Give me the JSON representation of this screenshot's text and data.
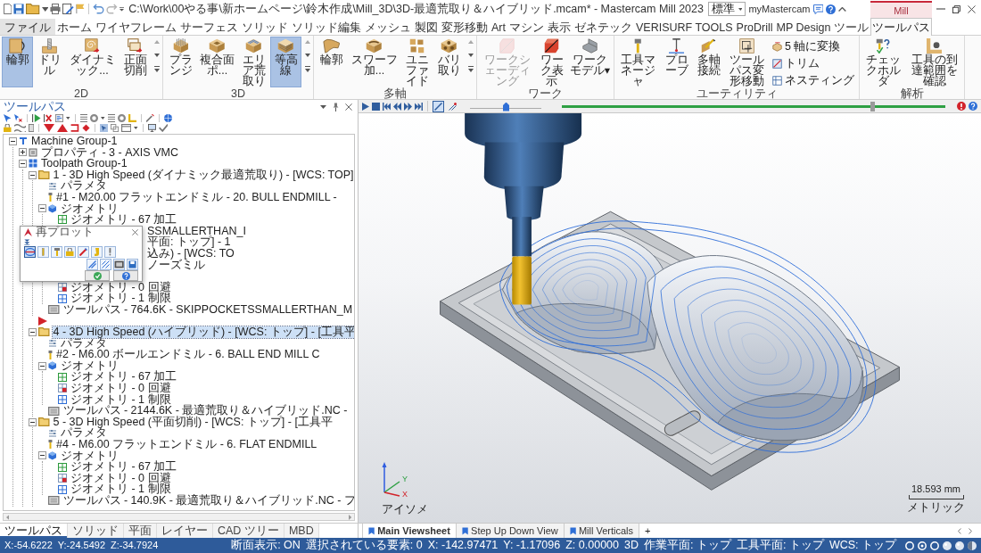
{
  "title_bar": {
    "title": "C:\\Work\\00やる事\\新ホームページ\\鈴木作成\\Mill_3D\\3D-最適荒取り＆ハイブリッド.mcam* - Mastercam Mill 2023",
    "context_tab": "Mill"
  },
  "menu_tabs": [
    {
      "label": "ファイル",
      "kind": "file",
      "selected": false
    },
    {
      "label": "ホーム",
      "kind": "tab",
      "selected": false
    },
    {
      "label": "ワイヤフレーム",
      "kind": "tab",
      "selected": false
    },
    {
      "label": "サーフェス",
      "kind": "tab",
      "selected": false
    },
    {
      "label": "ソリッド",
      "kind": "tab",
      "selected": false
    },
    {
      "label": "ソリッド編集",
      "kind": "tab",
      "selected": false
    },
    {
      "label": "メッシュ",
      "kind": "tab",
      "selected": false
    },
    {
      "label": "製図",
      "kind": "tab",
      "selected": false
    },
    {
      "label": "変形移動",
      "kind": "tab",
      "selected": false
    },
    {
      "label": "Art",
      "kind": "tab",
      "selected": false
    },
    {
      "label": "マシン",
      "kind": "tab",
      "selected": false
    },
    {
      "label": "表示",
      "kind": "tab",
      "selected": false
    },
    {
      "label": "ゼネテック",
      "kind": "tab",
      "selected": false
    },
    {
      "label": "VERISURF TOOLS",
      "kind": "tab",
      "selected": false
    },
    {
      "label": "ProDrill",
      "kind": "tab",
      "selected": false
    },
    {
      "label": "MP Design ツール",
      "kind": "tab",
      "selected": false
    },
    {
      "label": "ツールパス",
      "kind": "tab",
      "selected": true
    }
  ],
  "view_style": {
    "value": "標準"
  },
  "account_link": "myMastercam",
  "ribbon": [
    {
      "label": "2D",
      "gallery": true,
      "buttons": [
        {
          "label": "輪郭",
          "selected": true
        },
        {
          "label": "ドリル",
          "selected": false
        },
        {
          "label": "ダイナミック...",
          "selected": false
        },
        {
          "label": "正面切削",
          "selected": false
        }
      ]
    },
    {
      "label": "3D",
      "gallery": true,
      "buttons": [
        {
          "label": "プランジ",
          "selected": false
        },
        {
          "label": "複合面ポ...",
          "selected": false
        },
        {
          "label": "エリア荒取り",
          "selected": false
        },
        {
          "label": "等高線",
          "selected": true
        }
      ]
    },
    {
      "label": "多軸",
      "gallery": true,
      "buttons": [
        {
          "label": "輪郭",
          "selected": false
        },
        {
          "label": "スワーフ加...",
          "selected": false
        },
        {
          "label": "ユニファイド",
          "selected": false
        },
        {
          "label": "バリ取り",
          "selected": false
        }
      ]
    },
    {
      "label": "ワーク",
      "buttons": [
        {
          "label": "ワークシェーディング",
          "selected": false,
          "disabled": true
        },
        {
          "label": "ワーク表示",
          "selected": false,
          "disabled": false
        },
        {
          "label": "ワークモデル▾",
          "selected": false,
          "disabled": false
        }
      ]
    },
    {
      "label": "ユーティリティ",
      "buttons": [
        {
          "label": "工具マネージャ",
          "selected": false
        },
        {
          "label": "プローブ",
          "selected": false
        },
        {
          "label": "多軸接続",
          "selected": false
        },
        {
          "label": "ツールパス変形移動",
          "selected": false
        }
      ],
      "small_buttons": [
        {
          "label": "5 軸に変換"
        },
        {
          "label": "トリム"
        },
        {
          "label": "ネスティング"
        }
      ]
    },
    {
      "label": "解析",
      "buttons": [
        {
          "label": "チェックホルダ",
          "selected": false
        },
        {
          "label": "工具の到達範囲を確認",
          "selected": false
        }
      ]
    }
  ],
  "panel": {
    "title": "ツールパス",
    "tree": [
      {
        "text": "Machine Group-1",
        "kind": "machine",
        "expanded": true,
        "selected": false,
        "children": [
          {
            "text": "プロパティ - 3 - AXIS VMC",
            "kind": "properties",
            "expanded": false,
            "selected": false
          },
          {
            "text": "Toolpath Group-1",
            "kind": "group",
            "expanded": true,
            "selected": false,
            "children": [
              {
                "text": "1 - 3D High Speed (ダイナミック最適荒取り) - [WCS: TOP]",
                "kind": "operation",
                "expanded": true,
                "selected": false,
                "children": [
                  {
                    "text": "パラメタ",
                    "kind": "params",
                    "selected": false
                  },
                  {
                    "text": "#1 - M20.00 フラットエンドミル - 20. BULL ENDMILL -",
                    "kind": "tool",
                    "selected": false
                  },
                  {
                    "text": "ジオメトリ",
                    "kind": "geometry",
                    "expanded": true,
                    "selected": false,
                    "children": [
                      {
                        "text": "ジオメトリ - 67 加工",
                        "kind": "cutchain",
                        "selected": false
                      }
                    ]
                  },
                  {
                    "text": "SSMALLERTHAN_I",
                    "covered": true,
                    "selected": false
                  }
                ]
              },
              {
                "text": "平面: トップ] - 1",
                "covered": true,
                "selected": false
              },
              {
                "text": "込み) - [WCS: TO",
                "covered": true,
                "selected": false,
                "children": [
                  {
                    "text": "ノーズミル",
                    "covered": true,
                    "selected": false
                  },
                  {
                    "covered": true,
                    "children": [
                      {
                        "text": "ジオメトリ - 0 回避",
                        "kind": "avoidchain",
                        "selected": false
                      },
                      {
                        "text": "ジオメトリ - 1 制限",
                        "kind": "limitchain",
                        "selected": false
                      }
                    ]
                  },
                  {
                    "text": "ツールパス - 764.6K - SKIPPOCKETSSMALLERTHAN_M",
                    "kind": "toolpath",
                    "selected": false
                  }
                ]
              },
              {
                "kind": "marker"
              },
              {
                "text": "4 - 3D High Speed (ハイブリッド) - [WCS: トップ] - [工具平",
                "kind": "operation",
                "expanded": true,
                "selected": true,
                "children": [
                  {
                    "text": "パラメタ",
                    "kind": "params",
                    "selected": false
                  },
                  {
                    "text": "#2 - M6.00 ボールエンドミル - 6. BALL END MILL C",
                    "kind": "tool",
                    "selected": false
                  },
                  {
                    "text": "ジオメトリ",
                    "kind": "geometry",
                    "expanded": true,
                    "selected": false,
                    "children": [
                      {
                        "text": "ジオメトリ - 67 加工",
                        "kind": "cutchain",
                        "selected": false
                      },
                      {
                        "text": "ジオメトリ - 0 回避",
                        "kind": "avoidchain",
                        "selected": false
                      },
                      {
                        "text": "ジオメトリ - 1 制限",
                        "kind": "limitchain",
                        "selected": false
                      }
                    ]
                  },
                  {
                    "text": "ツールパス - 2144.6K - 最適荒取り＆ハイブリッド.NC -",
                    "kind": "toolpath",
                    "selected": false
                  }
                ]
              },
              {
                "text": "5 - 3D High Speed (平面切削) - [WCS: トップ] - [工具平",
                "kind": "operation",
                "expanded": true,
                "selected": false,
                "children": [
                  {
                    "text": "パラメタ",
                    "kind": "params",
                    "selected": false
                  },
                  {
                    "text": "#4 - M6.00 フラットエンドミル - 6. FLAT ENDMILL",
                    "kind": "tool",
                    "selected": false
                  },
                  {
                    "text": "ジオメトリ",
                    "kind": "geometry",
                    "expanded": true,
                    "selected": false,
                    "children": [
                      {
                        "text": "ジオメトリ - 67 加工",
                        "kind": "cutchain",
                        "selected": false
                      },
                      {
                        "text": "ジオメトリ - 0 回避",
                        "kind": "avoidchain",
                        "selected": false
                      },
                      {
                        "text": "ジオメトリ - 1 制限",
                        "kind": "limitchain",
                        "selected": false
                      }
                    ]
                  },
                  {
                    "text": "ツールパス - 140.9K - 最適荒取り＆ハイブリッド.NC - フ",
                    "kind": "toolpath",
                    "selected": false
                  }
                ]
              }
            ]
          }
        ]
      }
    ]
  },
  "dialog": {
    "title": "再プロット",
    "display_options": [
      {
        "on": true
      },
      {
        "on": false
      },
      {
        "on": false
      },
      {
        "on": false
      },
      {
        "on": false
      },
      {
        "on": false
      },
      {
        "on": false
      }
    ],
    "output_options": [
      {
        "on": false
      },
      {
        "on": false
      },
      {
        "on": false
      },
      {
        "on": false
      }
    ]
  },
  "viewport": {
    "backplot": {
      "toggles": [
        {
          "on": true
        },
        {
          "on": false
        }
      ],
      "speed": {
        "level": 0.5
      },
      "position": {
        "level": 0.81
      }
    },
    "axes": [
      "Y",
      "X"
    ],
    "view_name": "アイソメ",
    "scale": {
      "value": "18.593 mm",
      "units": "メトリック"
    }
  },
  "panel_tabs": [
    {
      "label": "ツールパス",
      "selected": true
    },
    {
      "label": "ソリッド",
      "selected": false
    },
    {
      "label": "平面",
      "selected": false
    },
    {
      "label": "レイヤー",
      "selected": false
    },
    {
      "label": "CAD ツリー",
      "selected": false
    },
    {
      "label": "MBD",
      "selected": false
    }
  ],
  "view_tabs": [
    {
      "label": "Main Viewsheet",
      "selected": true
    },
    {
      "label": "Step Up Down View",
      "selected": false
    },
    {
      "label": "Mill Verticals",
      "selected": false
    }
  ],
  "add_tab": "+",
  "status_bar": {
    "cursor": [
      "X:-54.6222",
      "Y:-24.5492",
      "Z:-34.7924"
    ],
    "items": [
      "断面表示: ON",
      "選択されている要素: 0",
      "X: -142.97471",
      "Y: -1.17096",
      "Z: 0.00000",
      "3D",
      "作業平面: トップ",
      "工具平面: トップ",
      "WCS: トップ"
    ]
  }
}
